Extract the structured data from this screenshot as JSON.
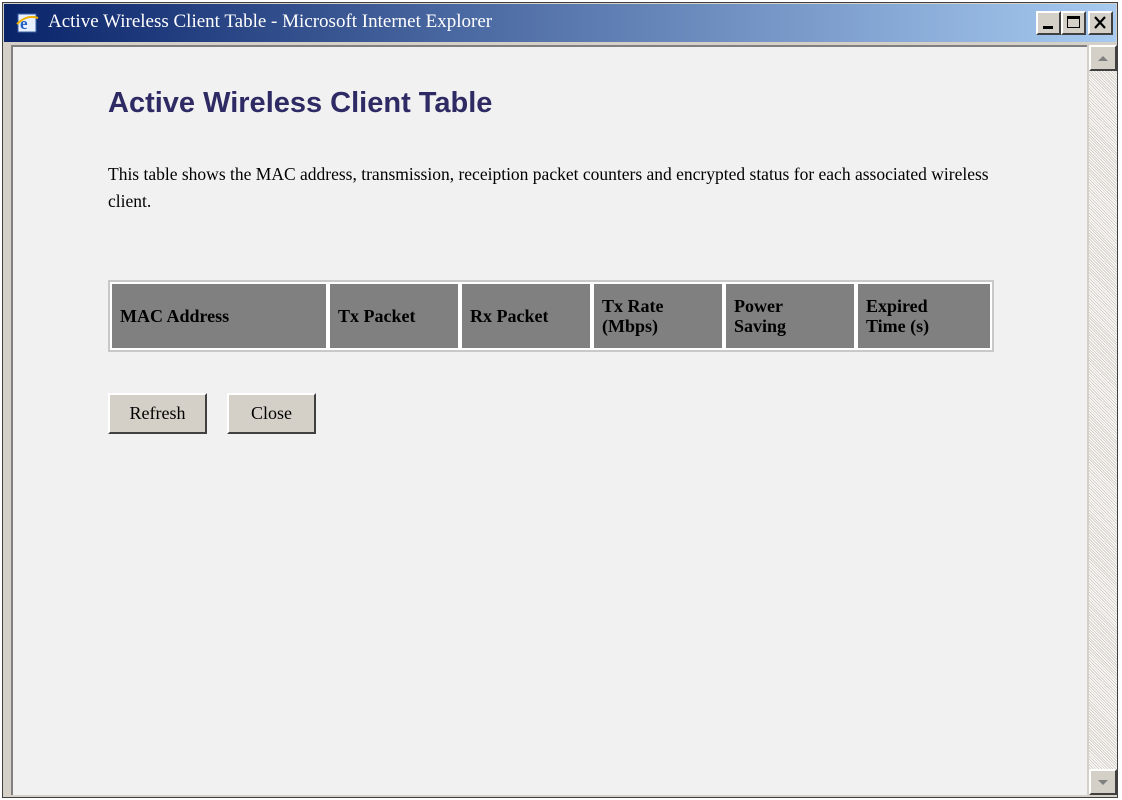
{
  "window": {
    "title": "Active Wireless Client Table - Microsoft Internet Explorer",
    "icon": "internet-explorer-icon",
    "controls": [
      "minimize-icon",
      "maximize-icon",
      "close-icon"
    ]
  },
  "page": {
    "title": "Active Wireless Client Table",
    "description": "This table shows the MAC address, transmission, receiption packet counters and encrypted status for each associated wireless client."
  },
  "table": {
    "headers": [
      {
        "line1": "MAC Address",
        "line2": ""
      },
      {
        "line1": "Tx Packet",
        "line2": ""
      },
      {
        "line1": "Rx Packet",
        "line2": ""
      },
      {
        "line1": "Tx Rate",
        "line2": "(Mbps)"
      },
      {
        "line1": "Power",
        "line2": "Saving"
      },
      {
        "line1": "Expired",
        "line2": "Time (s)"
      }
    ],
    "rows": []
  },
  "buttons": {
    "refresh": "Refresh",
    "close": "Close"
  },
  "colors": {
    "title_text": "#2e2a64",
    "header_bg": "#808080",
    "titlebar_start": "#0a246a",
    "titlebar_end": "#a6caf0"
  }
}
